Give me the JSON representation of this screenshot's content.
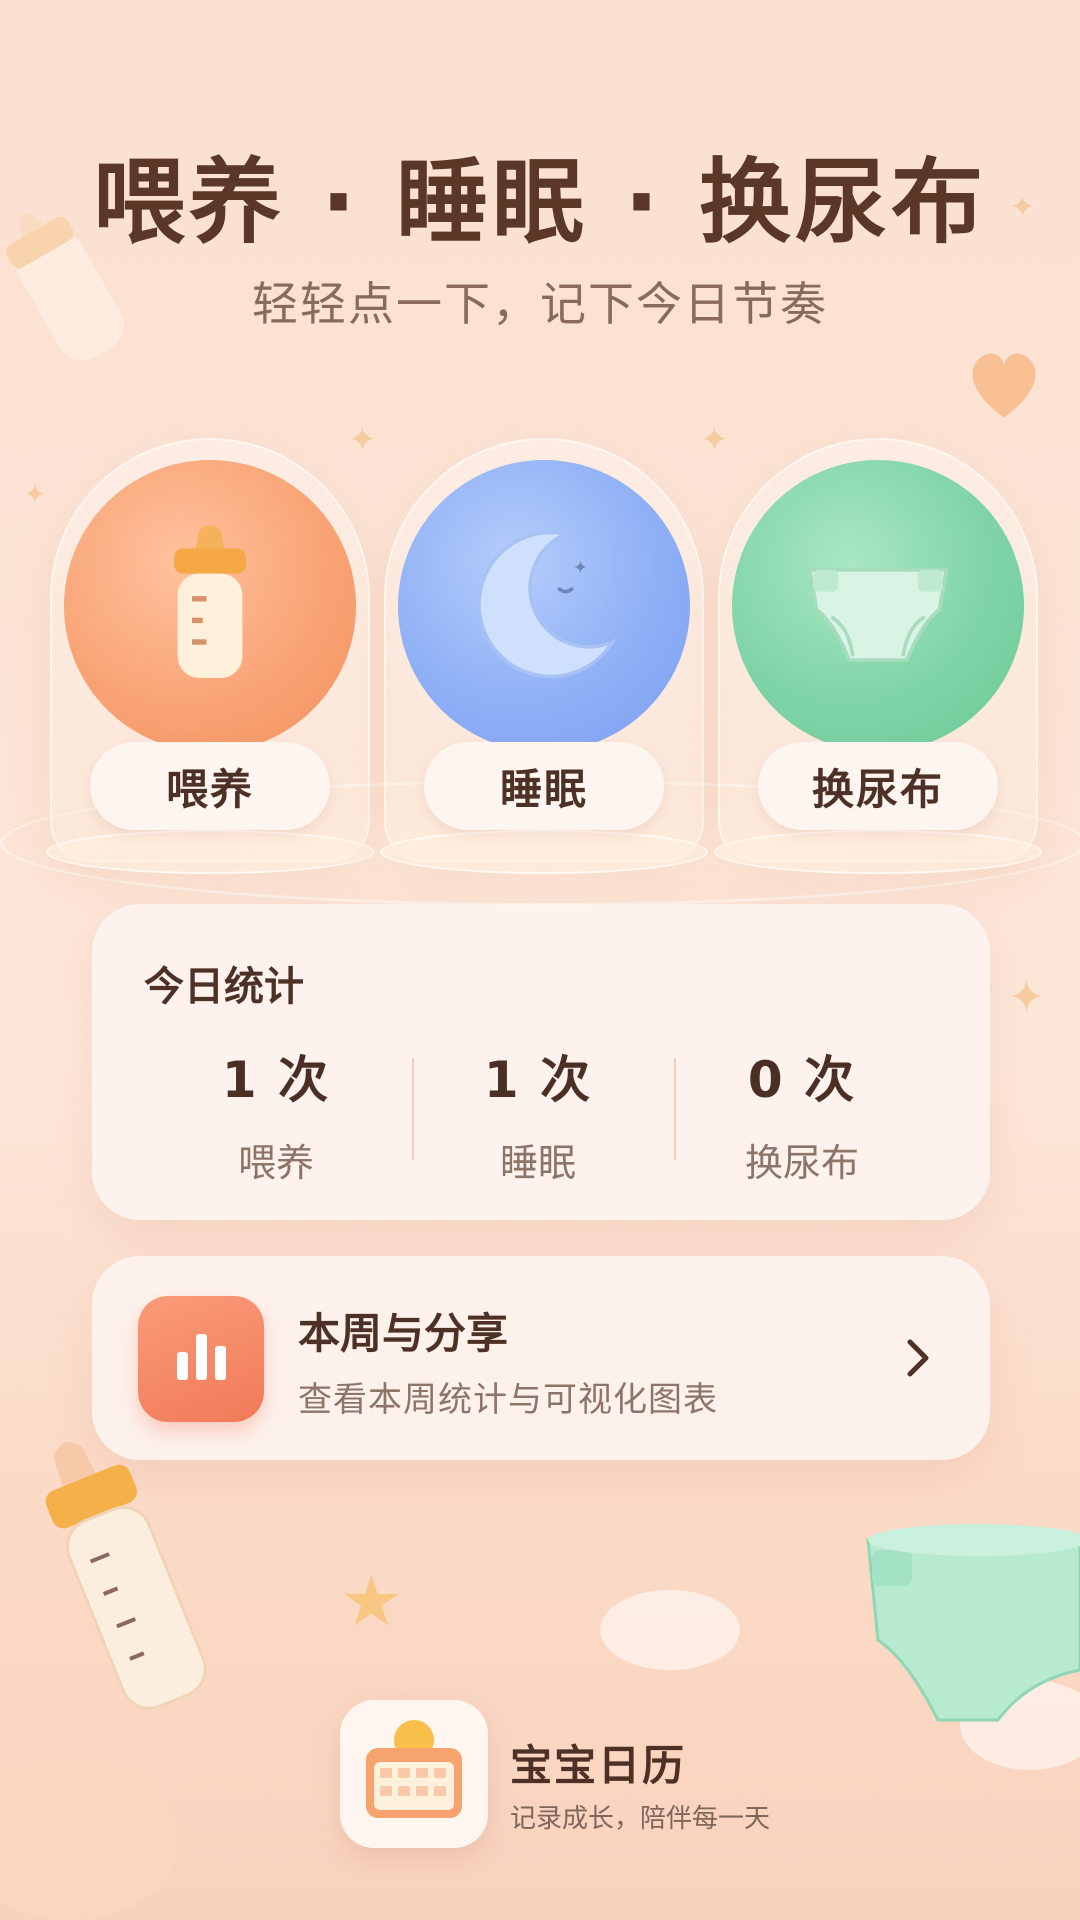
{
  "header": {
    "title": "喂养 · 睡眠 · 换尿布",
    "subtitle": "轻轻点一下，记下今日节奏"
  },
  "actions": [
    {
      "label": "喂养",
      "icon": "baby-bottle-icon",
      "color": "#f9a476"
    },
    {
      "label": "睡眠",
      "icon": "moon-icon",
      "color": "#8fb0f6"
    },
    {
      "label": "换尿布",
      "icon": "diaper-icon",
      "color": "#7fd4a7"
    }
  ],
  "stats": {
    "title": "今日统计",
    "items": [
      {
        "value": "1 次",
        "label": "喂养"
      },
      {
        "value": "1 次",
        "label": "睡眠"
      },
      {
        "value": "0 次",
        "label": "换尿布"
      }
    ]
  },
  "weekly": {
    "title": "本周与分享",
    "subtitle": "查看本周统计与可视化图表",
    "icon": "bar-chart-icon",
    "accent": "#f07a58"
  },
  "app": {
    "name": "宝宝日历",
    "slogan": "记录成长，陪伴每一天",
    "icon": "calendar-sun-icon"
  }
}
